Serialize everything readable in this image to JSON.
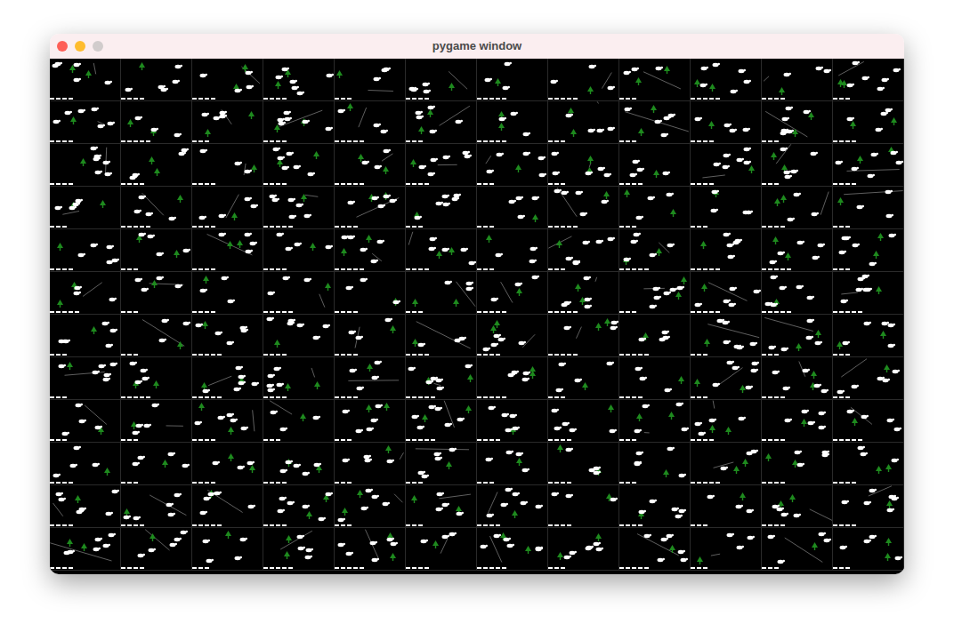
{
  "window": {
    "title": "pygame window",
    "traffic_lights": [
      {
        "name": "close",
        "color": "#fe5f57"
      },
      {
        "name": "minimize",
        "color": "#febc2e"
      },
      {
        "name": "zoom",
        "color": "#d1cccc"
      }
    ]
  },
  "grid": {
    "columns": 12,
    "rows": 12
  }
}
